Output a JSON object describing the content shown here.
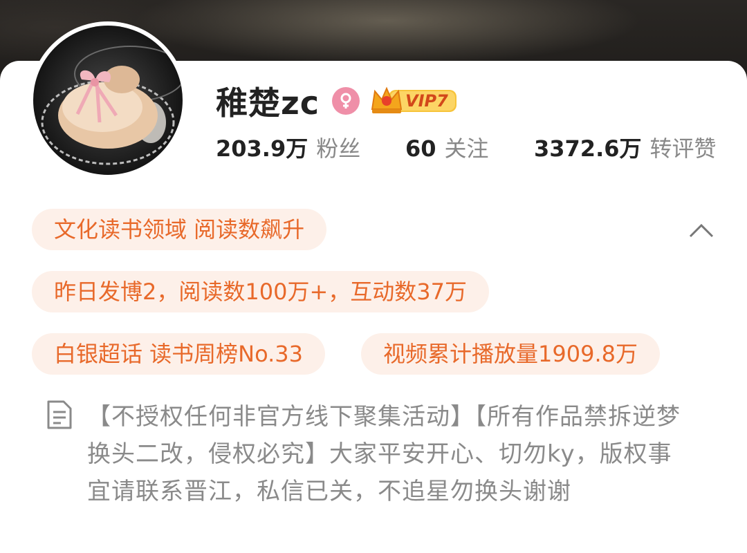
{
  "profile": {
    "name": "稚楚zc",
    "vip_label": "VIP7",
    "stats": [
      {
        "num": "203.9万",
        "label": "粉丝"
      },
      {
        "num": "60",
        "label": "关注"
      },
      {
        "num": "3372.6万",
        "label": "转评赞"
      }
    ],
    "tags": [
      "文化读书领域 阅读数飙升",
      "昨日发博2，阅读数100万+，互动数37万",
      "白银超话 读书周榜No.33",
      "视频累计播放量1909.8万"
    ],
    "bio": "【不授权任何非官方线下聚集活动】【所有作品禁拆逆梦换头二改，侵权必究】大家平安开心、切勿ky，版权事宜请联系晋江，私信已关，不追星勿换头谢谢"
  },
  "colors": {
    "accent": "#e8692a",
    "pill_bg": "#fdf0e9",
    "gender_badge": "#ef8fa8",
    "vip_gold": "#f4b11c",
    "text_primary": "#222222",
    "text_secondary": "#888888"
  },
  "icons": {
    "gender": "female-icon",
    "vip": "crown-icon",
    "collapse": "chevron-up-icon",
    "bio": "document-icon"
  }
}
